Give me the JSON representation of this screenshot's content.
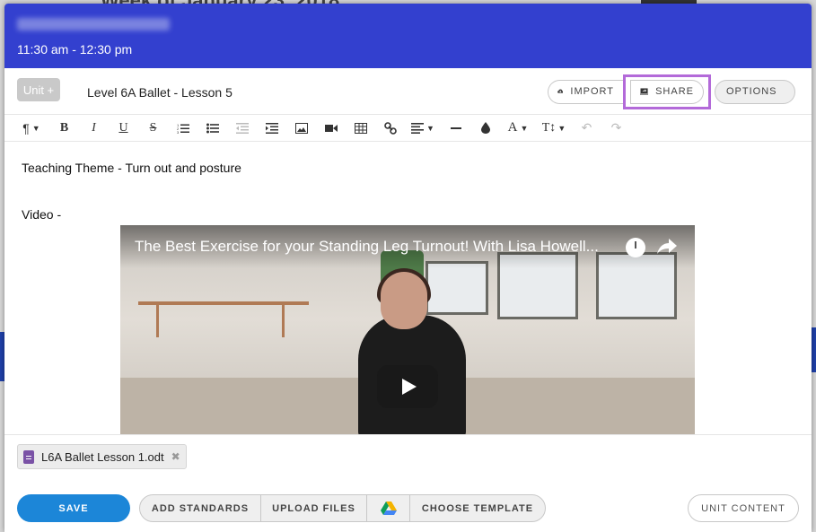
{
  "background": {
    "title_partial": "Week of January 23, 2018"
  },
  "header": {
    "time_range": "11:30 am - 12:30 pm",
    "accent_color": "#3340cf"
  },
  "title_row": {
    "unit_button": "Unit +",
    "lesson_title": "Level 6A Ballet - Lesson 5",
    "import_label": "IMPORT",
    "share_label": "SHARE",
    "options_label": "OPTIONS",
    "highlight_color": "#b36ad9"
  },
  "toolbar": {
    "buttons": [
      "paragraph-icon",
      "bold-icon",
      "italic-icon",
      "underline-icon",
      "strikethrough-icon",
      "ordered-list-icon",
      "unordered-list-icon",
      "outdent-icon",
      "indent-icon",
      "image-icon",
      "video-icon",
      "table-icon",
      "link-icon",
      "align-icon",
      "horizontal-rule-icon",
      "color-icon",
      "font-size-icon",
      "text-height-icon",
      "undo-icon",
      "redo-icon"
    ]
  },
  "editor": {
    "line1": "Teaching Theme - Turn out and posture",
    "line2": "Video -",
    "video_title": "The Best Exercise for your Standing Leg Turnout! With Lisa Howell..."
  },
  "attachments": {
    "file_name": "L6A Ballet Lesson 1.odt"
  },
  "footer": {
    "save": "SAVE",
    "add_standards": "ADD STANDARDS",
    "upload_files": "UPLOAD FILES",
    "choose_template": "CHOOSE TEMPLATE",
    "unit_content": "UNIT CONTENT",
    "save_color": "#1c86d8"
  }
}
